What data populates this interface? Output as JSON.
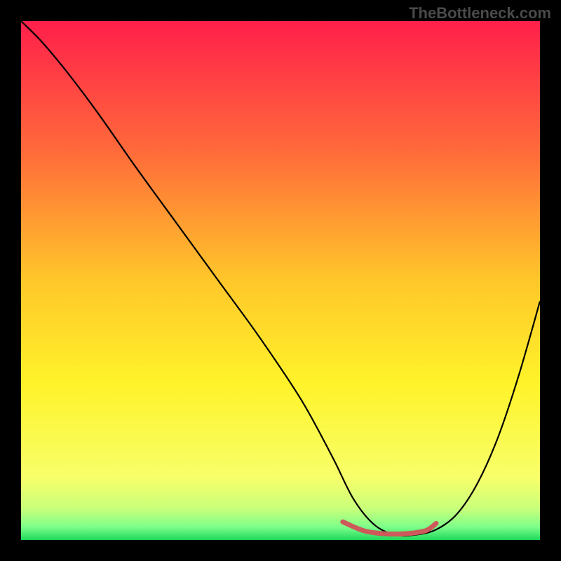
{
  "watermark": "TheBottleneck.com",
  "chart_data": {
    "type": "line",
    "title": "",
    "xlabel": "",
    "ylabel": "",
    "xlim": [
      0,
      100
    ],
    "ylim": [
      0,
      100
    ],
    "background_gradient": {
      "stops": [
        {
          "offset": 0,
          "color": "#ff1f4b"
        },
        {
          "offset": 0.25,
          "color": "#ff6a3a"
        },
        {
          "offset": 0.5,
          "color": "#ffc72a"
        },
        {
          "offset": 0.7,
          "color": "#fff32a"
        },
        {
          "offset": 0.88,
          "color": "#f7ff6a"
        },
        {
          "offset": 0.94,
          "color": "#c8ff7a"
        },
        {
          "offset": 0.975,
          "color": "#7dff8a"
        },
        {
          "offset": 1.0,
          "color": "#1fd85a"
        }
      ]
    },
    "series": [
      {
        "name": "bottleneck-curve",
        "color": "#000000",
        "width": 2.2,
        "x": [
          0,
          4,
          9,
          15,
          22,
          30,
          38,
          46,
          54,
          60,
          64,
          68,
          72,
          76,
          80,
          84,
          88,
          92,
          96,
          100
        ],
        "y": [
          100,
          96,
          90,
          82,
          72,
          61,
          50,
          39,
          27,
          16,
          8,
          3,
          1,
          1,
          2,
          5,
          11,
          20,
          32,
          46
        ]
      }
    ],
    "flat_zone": {
      "color": "#cc5a5a",
      "width": 7,
      "x": [
        62,
        66,
        70,
        74,
        78,
        80
      ],
      "y": [
        3.5,
        1.8,
        1.2,
        1.2,
        1.8,
        3.2
      ]
    }
  }
}
